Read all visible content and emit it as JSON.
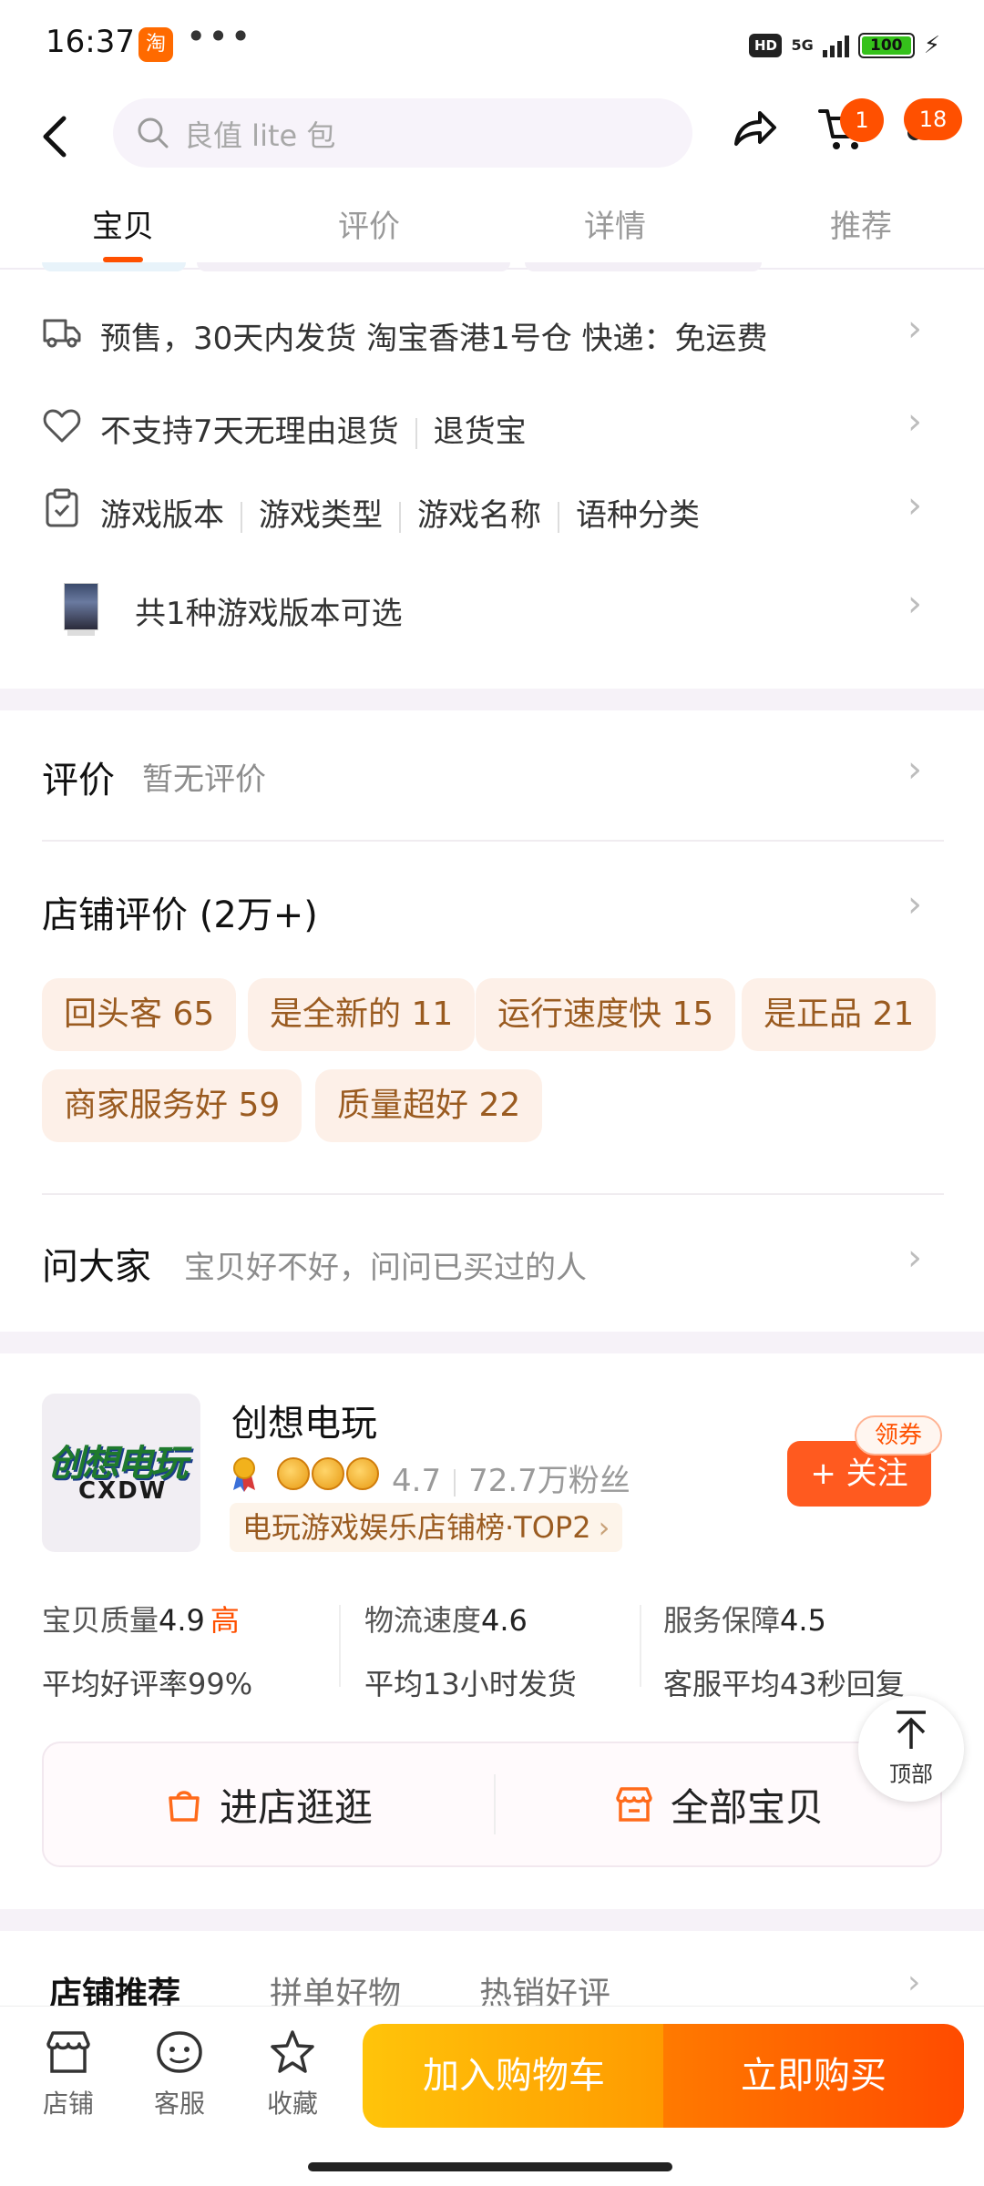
{
  "status_bar": {
    "time": "16:37",
    "app_badge": "淘",
    "more": "•••",
    "hd": "HD",
    "network": "5G",
    "battery": "100"
  },
  "nav": {
    "search_placeholder": "良值 lite 包",
    "cart_count": "1",
    "message_count": "18"
  },
  "tabs": [
    {
      "label": "宝贝",
      "active": true
    },
    {
      "label": "评价",
      "active": false
    },
    {
      "label": "详情",
      "active": false
    },
    {
      "label": "推荐",
      "active": false
    }
  ],
  "shipping": {
    "text": "预售，30天内发货 淘宝香港1号仓 快递：免运费"
  },
  "returns": {
    "policy": "不支持7天无理由退货",
    "service": "退货宝"
  },
  "attributes": [
    "游戏版本",
    "游戏类型",
    "游戏名称",
    "语种分类"
  ],
  "variants": {
    "text": "共1种游戏版本可选"
  },
  "reviews": {
    "title": "评价",
    "status": "暂无评价"
  },
  "store_reviews": {
    "title": "店铺评价 (2万+)",
    "tags": [
      "回头客 65",
      "是全新的 11",
      "运行速度快 15",
      "是正品 21",
      "商家服务好 59",
      "质量超好 22"
    ]
  },
  "ask": {
    "title": "问大家",
    "prompt": "宝贝好不好，问问已买过的人"
  },
  "store": {
    "logo_text": "创想电玩",
    "logo_sub": "CXDW",
    "name": "创想电玩",
    "rating": "4.7",
    "fans": "72.7万粉丝",
    "rank": "电玩游戏娱乐店铺榜·TOP2",
    "follow_label": "+ 关注",
    "coupon_label": "领券",
    "metrics": [
      {
        "label": "宝贝质量",
        "value": "4.9",
        "level": "高",
        "sub": "平均好评率99%"
      },
      {
        "label": "物流速度",
        "value": "4.6",
        "level": "",
        "sub": "平均13小时发货"
      },
      {
        "label": "服务保障",
        "value": "4.5",
        "level": "",
        "sub": "客服平均43秒回复"
      }
    ],
    "enter_label": "进店逛逛",
    "all_items_label": "全部宝贝",
    "top_label": "顶部"
  },
  "recommend_tabs": [
    "店铺推荐",
    "拼单好物",
    "热销好评"
  ],
  "bottom_bar": {
    "shop_label": "店铺",
    "service_label": "客服",
    "favorite_label": "收藏",
    "add_cart_label": "加入购物车",
    "buy_now_label": "立即购买"
  },
  "colors": {
    "accent": "#ff5000",
    "tag_bg": "#fdf0e8",
    "tag_text": "#9a5b20"
  }
}
